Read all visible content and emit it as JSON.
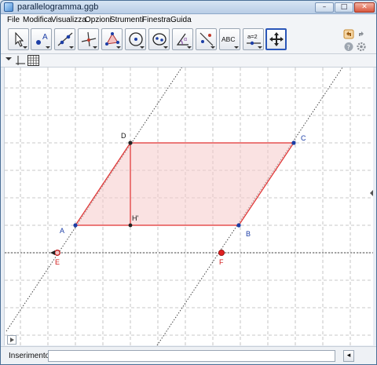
{
  "window": {
    "title": "parallelogramma.ggb",
    "controls": [
      "–",
      "□",
      "✕"
    ]
  },
  "menubar": {
    "items": [
      "File",
      "Modifica",
      "Visualizza",
      "Opzioni",
      "Strumenti",
      "Finestra",
      "Guida"
    ]
  },
  "toolbar": {
    "tools": [
      {
        "name": "move-tool",
        "icon": "arrow-cursor-icon"
      },
      {
        "name": "new-point-tool",
        "icon": "point-icon",
        "label": "A"
      },
      {
        "name": "line-tool",
        "icon": "line-through-points-icon"
      },
      {
        "name": "perpendicular-line-tool",
        "icon": "perpendicular-line-icon"
      },
      {
        "name": "polygon-tool",
        "icon": "polygon-icon"
      },
      {
        "name": "circle-tool",
        "icon": "circle-icon"
      },
      {
        "name": "conic-tool",
        "icon": "ellipse-icon"
      },
      {
        "name": "angle-tool",
        "icon": "angle-icon"
      },
      {
        "name": "reflect-tool",
        "icon": "reflect-about-line-icon"
      },
      {
        "name": "text-tool",
        "icon": "text-icon",
        "label": "ABC"
      },
      {
        "name": "slider-tool",
        "icon": "slider-icon",
        "label": "a=2"
      },
      {
        "name": "move-graphics-view-tool",
        "icon": "move-graphics-view-icon",
        "selected": true
      }
    ],
    "right_buttons": [
      "undo-icon",
      "redo-icon",
      "help-icon",
      "settings-icon"
    ]
  },
  "stylebar": {
    "buttons": [
      "axes-toggle-icon",
      "grid-toggle-icon"
    ]
  },
  "graphics": {
    "points": [
      {
        "id": "A",
        "label": "A",
        "color": "#1c3ea6"
      },
      {
        "id": "B",
        "label": "B",
        "color": "#1c3ea6"
      },
      {
        "id": "C",
        "label": "C",
        "color": "#1c3ea6"
      },
      {
        "id": "D",
        "label": "D",
        "color": "#000000"
      },
      {
        "id": "H",
        "label": "H'",
        "color": "#000000"
      },
      {
        "id": "E",
        "label": "E",
        "color": "#d11a1a"
      },
      {
        "id": "F",
        "label": "F",
        "color": "#d11a1a"
      }
    ],
    "colors": {
      "parallelogram_fill": "#f6caca",
      "parallelogram_edge": "#e03030",
      "grid": "#b8b8b8",
      "lines": "#555555"
    }
  },
  "inputbar": {
    "label": "Inserimento:",
    "value": "",
    "button_icon": "input-help-icon"
  }
}
